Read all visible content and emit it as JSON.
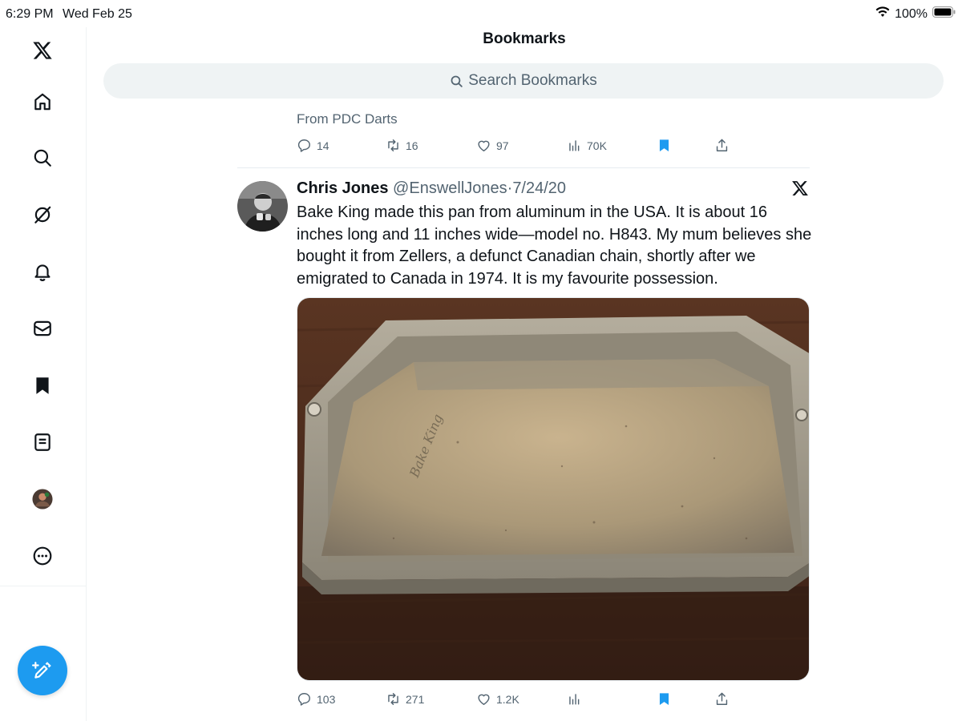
{
  "status_bar": {
    "time": "6:29 PM",
    "date": "Wed Feb 25",
    "battery": "100%"
  },
  "sidebar": {
    "items": [
      {
        "name": "x-logo-icon"
      },
      {
        "name": "home-icon"
      },
      {
        "name": "search-icon"
      },
      {
        "name": "grok-icon"
      },
      {
        "name": "notifications-bell-icon"
      },
      {
        "name": "messages-envelope-icon"
      },
      {
        "name": "bookmark-icon"
      },
      {
        "name": "lists-icon"
      },
      {
        "name": "profile-avatar"
      },
      {
        "name": "more-icon"
      }
    ],
    "compose_icon": "compose-feather-plus-icon"
  },
  "header": {
    "title": "Bookmarks"
  },
  "search": {
    "placeholder": "Search Bookmarks"
  },
  "colors": {
    "accent": "#1d9bf0",
    "secondary_text": "#536471",
    "search_bg": "#eff3f4"
  },
  "previous_tweet": {
    "from_text": "From PDC Darts",
    "stats": {
      "replies": "14",
      "reposts": "16",
      "likes": "97",
      "views": "70K"
    }
  },
  "tweet": {
    "name": "Chris Jones",
    "handle": "@EnswellJones",
    "separator": "·",
    "date": "7/24/20",
    "text": "Bake King made this pan from aluminum in the USA. It is about 16 inches long and 11 inches wide—model no. H843. My mum believes she bought it from Zellers, a defunct Canadian chain, shortly after we emigrated to Canada in 1974. It is my favourite possession.",
    "stats": {
      "replies": "103",
      "reposts": "271",
      "likes": "1.2K",
      "views": ""
    }
  }
}
